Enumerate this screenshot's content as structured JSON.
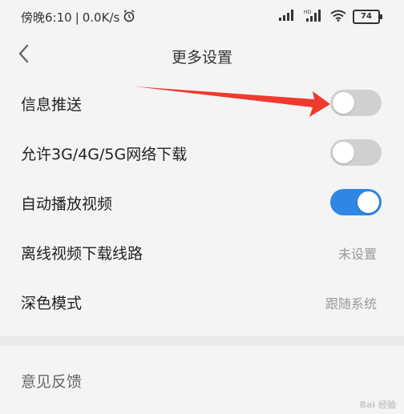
{
  "status_bar": {
    "time": "傍晚6:10",
    "separator": "|",
    "network_speed": "0.0K/s",
    "battery_level": "74",
    "icons": [
      "alarm-icon",
      "signal-icon",
      "signal-hd-icon",
      "wifi-icon",
      "battery-icon"
    ]
  },
  "header": {
    "title": "更多设置",
    "back_icon": "chevron-left-icon"
  },
  "settings": {
    "items": [
      {
        "label": "信息推送",
        "type": "toggle",
        "state": "off"
      },
      {
        "label": "允许3G/4G/5G网络下载",
        "type": "toggle",
        "state": "off"
      },
      {
        "label": "自动播放视频",
        "type": "toggle",
        "state": "on"
      },
      {
        "label": "离线视频下载线路",
        "type": "value",
        "value": "未设置"
      },
      {
        "label": "深色模式",
        "type": "value",
        "value": "跟随系统"
      }
    ]
  },
  "section2": {
    "feedback_label": "意见反馈"
  },
  "annotation": {
    "arrow_color": "#f03a2e"
  },
  "watermark": {
    "text": "Bai 经验"
  },
  "colors": {
    "accent": "#2f86e5",
    "toggle_off": "#d0d0d0",
    "background": "#f4f4f4"
  }
}
